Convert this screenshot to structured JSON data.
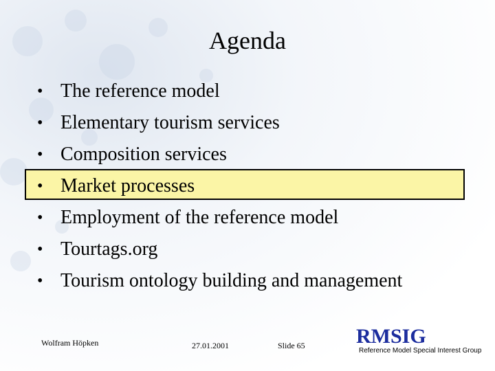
{
  "title": "Agenda",
  "agenda": {
    "items": [
      "The reference model",
      "Elementary tourism services",
      "Composition services",
      "Market processes",
      "Employment of the reference model",
      "Tourtags.org",
      "Tourism ontology building and management"
    ],
    "bullet": "•",
    "highlighted_item": "Market processes"
  },
  "footer": {
    "author": "Wolfram Höpken",
    "date": "27.01.2001",
    "slide": "Slide 65"
  },
  "logo": {
    "name": "RMSIG",
    "subtitle": "Reference Model Special Interest Group"
  },
  "colors": {
    "highlight_fill": "#fbf5a6",
    "logo": "#1c2d9e"
  }
}
